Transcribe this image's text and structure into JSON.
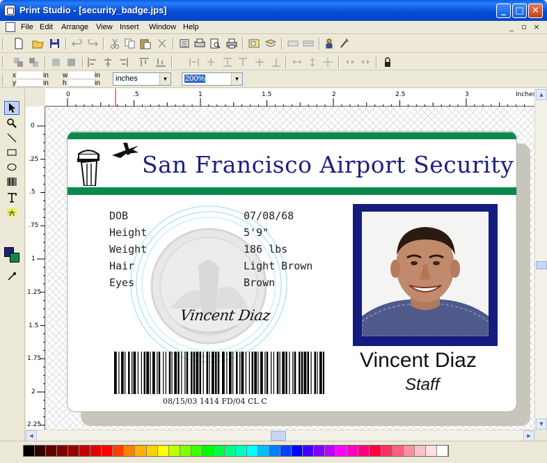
{
  "window": {
    "title": "Print Studio - [security_badge.jps]",
    "minimize": "_",
    "maximize": "□",
    "close": "✕"
  },
  "menu": [
    "File",
    "Edit",
    "Arrange",
    "View",
    "Insert",
    "Window",
    "Help"
  ],
  "mdi_controls": {
    "minimize": "_",
    "restore": "▫",
    "close": "×"
  },
  "position_bar": {
    "x_label": "x",
    "y_label": "y",
    "w_label": "w",
    "h_label": "h",
    "unit_label": "in",
    "units_selected": "inches",
    "zoom_selected": "200%"
  },
  "ruler": {
    "unit_label": "Inches",
    "top_ticks": [
      "0",
      ".5",
      "1",
      "1.5",
      "2",
      "2.5",
      "3"
    ],
    "left_ticks": [
      "0",
      ".25",
      ".5",
      ".75",
      "1",
      "1.25",
      "1.5",
      "1.75",
      "2",
      "2.25"
    ]
  },
  "badge": {
    "heading": "San Francisco Airport Security",
    "fields": [
      {
        "label": "DOB",
        "value": "07/08/68"
      },
      {
        "label": "Height",
        "value": "5'9\""
      },
      {
        "label": "Weight",
        "value": "186 lbs"
      },
      {
        "label": "Hair",
        "value": "Light Brown"
      },
      {
        "label": "Eyes",
        "value": "Brown"
      }
    ],
    "signature": "Vincent Diaz",
    "barcode_text": "08/15/03  1414  FD/04 CL C",
    "name": "Vincent Diaz",
    "role": "Staff",
    "colors": {
      "band": "#0c8a4e",
      "heading": "#1a2280",
      "photo_frame": "#141c80"
    }
  },
  "palette_colors": [
    "#000000",
    "#330000",
    "#660000",
    "#800000",
    "#990000",
    "#c00000",
    "#e00000",
    "#ff0000",
    "#ff4000",
    "#ff8000",
    "#ffb000",
    "#ffd000",
    "#ffff00",
    "#c0ff00",
    "#80ff00",
    "#40ff00",
    "#00ff00",
    "#00ff40",
    "#00ff80",
    "#00ffc0",
    "#00ffff",
    "#00c0ff",
    "#0080ff",
    "#0040ff",
    "#0000ff",
    "#4000ff",
    "#8000ff",
    "#c000ff",
    "#ff00ff",
    "#ff00c0",
    "#ff0080",
    "#ff0040",
    "#ff3060",
    "#ff6080",
    "#ff90a0",
    "#ffc0c8",
    "#ffe0e4",
    "#ffffff"
  ],
  "icons": {
    "tools": [
      "arrow-pointer-icon",
      "zoom-icon",
      "line-icon",
      "rectangle-icon",
      "ellipse-icon",
      "barcode-icon",
      "text-icon",
      "image-icon"
    ]
  }
}
